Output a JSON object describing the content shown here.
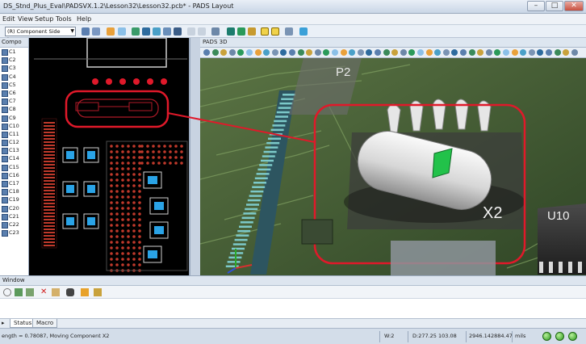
{
  "window": {
    "title": "DS_Stnd_Plus_Eval\\PADSVX.1.2\\Lesson32\\Lesson32.pcb* - PADS Layout"
  },
  "menu": [
    "Edit",
    "View",
    "Setup",
    "Tools",
    "Help"
  ],
  "toolbar": {
    "layer_select": "(R) Component Side Lay..."
  },
  "left_panel": {
    "header": "Compo",
    "items": [
      "C1",
      "C2",
      "C3",
      "C4",
      "C5",
      "C6",
      "C7",
      "C8",
      "C9",
      "C10",
      "C11",
      "C12",
      "C13",
      "C14",
      "C15",
      "C16",
      "C17",
      "C18",
      "C19",
      "C20",
      "C21",
      "C22",
      "C23"
    ]
  },
  "view3d": {
    "title": "PADS 3D",
    "labels": {
      "p2": "P2",
      "x2": "X2",
      "u10": "U10"
    }
  },
  "output_window": {
    "title": "Window"
  },
  "tabs": [
    "Status",
    "Macro"
  ],
  "status": {
    "message": "ength = 0.78087, Moving Component X2",
    "w": "W:2",
    "coords": "D:277.25 103.08",
    "x": "2946.14",
    "y": "2884.47",
    "units": "mils"
  },
  "colors": {
    "highlight": "#e0192a",
    "pcb_background": "#000000",
    "board_green": "#41573a",
    "pad_blue": "#2aa3e6",
    "marker_green": "#22c24a"
  }
}
